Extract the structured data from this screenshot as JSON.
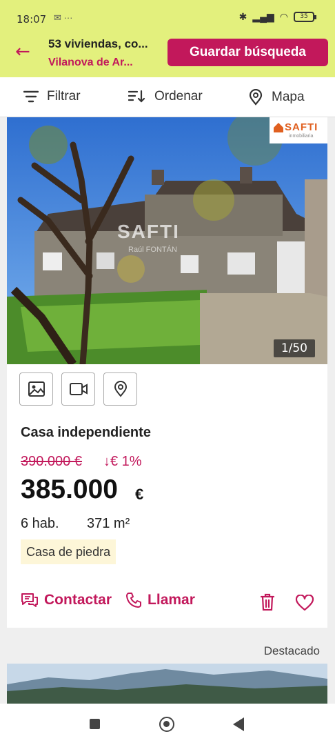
{
  "status": {
    "time": "18:07",
    "notif_icons": "✉ ···",
    "battery": "35"
  },
  "header": {
    "title": "53 viviendas, co...",
    "subtitle": "Vilanova de Ar...",
    "save_label": "Guardar búsqueda"
  },
  "toolbar": {
    "filter": "Filtrar",
    "sort": "Ordenar",
    "map": "Mapa"
  },
  "listing": {
    "badge_brand": "SAFTI",
    "badge_sub": "inmobiliaria",
    "watermark": "SAFTI",
    "watermark_sub": "Raúl FONTÁN",
    "photo_counter": "1/50",
    "type": "Casa independiente",
    "old_price": "390.000 €",
    "price_drop": "↓€ 1%",
    "price": "385.000",
    "currency": "€",
    "rooms": "6 hab.",
    "area": "371 m²",
    "tag": "Casa de piedra",
    "contact_label": "Contactar",
    "call_label": "Llamar"
  },
  "featured_label": "Destacado",
  "colors": {
    "accent": "#c2185b",
    "header_bg": "#e3f07d"
  }
}
